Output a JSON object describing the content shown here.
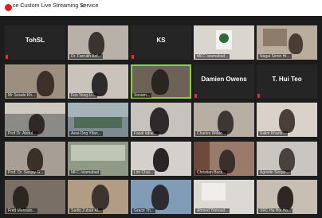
{
  "window": {
    "title": "ce Custom Live Streaming Service",
    "close_glyph": "✕"
  },
  "tiles": [
    {
      "id": "tohsl",
      "label": "TohSL",
      "big": "TohSL"
    },
    {
      "id": "farrukh",
      "label": "Dr. Farrukh Arif..."
    },
    {
      "id": "ks",
      "label": "KS",
      "big": "KS"
    },
    {
      "id": "mfa",
      "label": "MFC Islamabad..."
    },
    {
      "id": "nagai",
      "label": "Nagai Sirnin Hi..."
    },
    {
      "id": "sosale",
      "label": "Mr Sosale Kh..."
    },
    {
      "id": "foo",
      "label": "Foo Yong Li..."
    },
    {
      "id": "active",
      "label": "Sonam..."
    },
    {
      "id": "damien",
      "label": "Damien Owens",
      "big": "Damien Owens"
    },
    {
      "id": "huiteo",
      "label": "T. Hui Teo",
      "big": "T. Hui Teo"
    },
    {
      "id": "abdul",
      "label": "Prof Dr. Abdul..."
    },
    {
      "id": "aeai",
      "label": "Aeai-Ong Yifan..."
    },
    {
      "id": "iqbal",
      "label": "Fasal Iqbal..."
    },
    {
      "id": "charles",
      "label": "Charles Wilkie..."
    },
    {
      "id": "salim",
      "label": "Salim Kharbi..."
    },
    {
      "id": "sanjay",
      "label": "Prof. Dr. Sanjay G..."
    },
    {
      "id": "islamabad",
      "label": "MFC Islamabad"
    },
    {
      "id": "lim",
      "label": "Lim Chai..."
    },
    {
      "id": "christian",
      "label": "Christian Bock..."
    },
    {
      "id": "agostin",
      "label": "Agostin Sergio..."
    },
    {
      "id": "morsal",
      "label": "Fred Mensalo..."
    },
    {
      "id": "zubair",
      "label": "Sadiq Zubair Al..."
    },
    {
      "id": "grace",
      "label": "Grace Th..."
    },
    {
      "id": "ahmed",
      "label": "Ahmed Yomoud..."
    },
    {
      "id": "hehe",
      "label": "XRC Ha Hoi Ho..."
    }
  ]
}
